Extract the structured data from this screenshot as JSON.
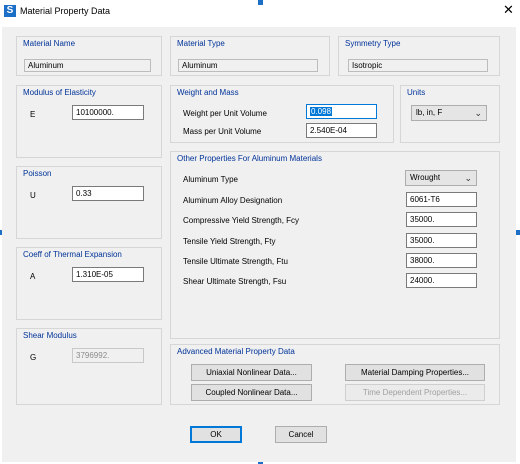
{
  "window": {
    "title": "Material Property Data",
    "app_icon_letter": "S",
    "close_glyph": "✕"
  },
  "material_name": {
    "title": "Material Name",
    "value": "Aluminum"
  },
  "material_type": {
    "title": "Material Type",
    "value": "Aluminum"
  },
  "symmetry_type": {
    "title": "Symmetry Type",
    "value": "Isotropic"
  },
  "elasticity": {
    "title": "Modulus of Elasticity",
    "symbol": "E",
    "value": "10100000."
  },
  "poisson": {
    "title": "Poisson",
    "symbol": "U",
    "value": "0.33"
  },
  "thermal": {
    "title": "Coeff of Thermal Expansion",
    "symbol": "A",
    "value": "1.310E-05"
  },
  "shear": {
    "title": "Shear Modulus",
    "symbol": "G",
    "value": "3796992."
  },
  "weight_mass": {
    "title": "Weight and Mass",
    "weight_label": "Weight per Unit Volume",
    "weight_value": "0.098",
    "mass_label": "Mass per Unit Volume",
    "mass_value": "2.540E-04"
  },
  "units": {
    "title": "Units",
    "selected": "lb, in, F"
  },
  "other": {
    "title": "Other Properties For Aluminum Materials",
    "rows": [
      {
        "label": "Aluminum Type",
        "value": "Wrought"
      },
      {
        "label": "Aluminum Alloy Designation",
        "value": "6061-T6"
      },
      {
        "label": "Compressive Yield Strength, Fcy",
        "value": "35000."
      },
      {
        "label": "Tensile Yield Strength, Fty",
        "value": "35000."
      },
      {
        "label": "Tensile Ultimate Strength, Ftu",
        "value": "38000."
      },
      {
        "label": "Shear Ultimate Strength, Fsu",
        "value": "24000."
      }
    ]
  },
  "advanced": {
    "title": "Advanced Material Property Data",
    "uniaxial": "Uniaxial Nonlinear Data...",
    "damping": "Material Damping Properties...",
    "coupled": "Coupled Nonlinear Data...",
    "time_dependent": "Time Dependent Properties..."
  },
  "buttons": {
    "ok": "OK",
    "cancel": "Cancel"
  },
  "colors": {
    "group_title": "#003399",
    "accent": "#0078d7",
    "client_bg": "#f0f0f0"
  }
}
